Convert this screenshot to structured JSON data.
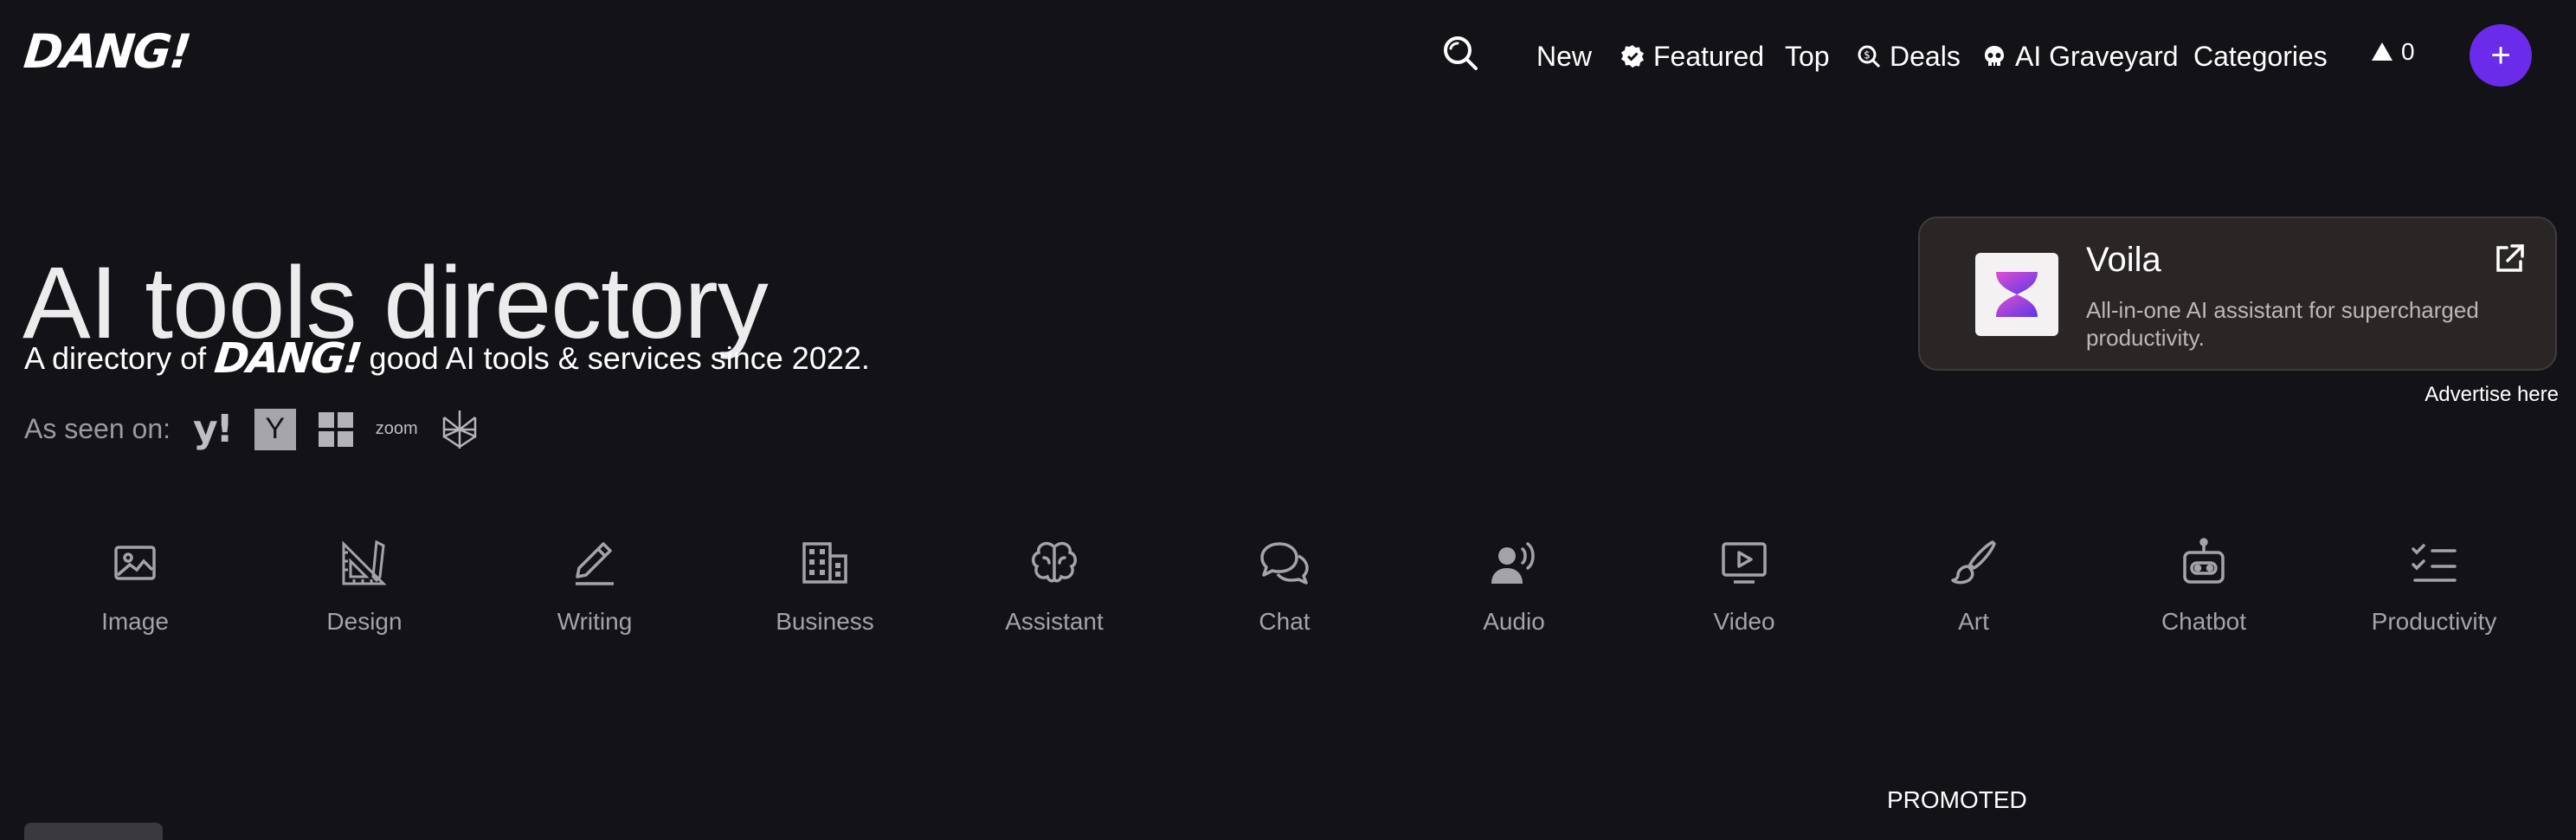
{
  "header": {
    "logo_text": "DANG!",
    "nav": [
      {
        "label": "New"
      },
      {
        "label": "Featured"
      },
      {
        "label": "Top"
      },
      {
        "label": "Deals"
      },
      {
        "label": "AI Graveyard"
      },
      {
        "label": "Categories"
      }
    ],
    "notification_count": "0",
    "add_label": "+"
  },
  "hero": {
    "title": "AI tools directory",
    "subtitle_before": "A directory of",
    "subtitle_logo": "DANG!",
    "subtitle_after": "good AI tools & services since 2022.",
    "seen_on_label": "As seen on:",
    "press": {
      "yahoo": "y!",
      "ycombinator": "Y",
      "zoom": "zoom"
    }
  },
  "promo": {
    "name": "Voila",
    "description": "All-in-one AI assistant for supercharged productivity.",
    "advertise_label": "Advertise here",
    "promoted_label": "PROMOTED"
  },
  "categories": [
    {
      "label": "Image",
      "icon": "image-icon"
    },
    {
      "label": "Design",
      "icon": "design-icon"
    },
    {
      "label": "Writing",
      "icon": "pencil-icon"
    },
    {
      "label": "Business",
      "icon": "building-icon"
    },
    {
      "label": "Assistant",
      "icon": "brain-icon"
    },
    {
      "label": "Chat",
      "icon": "chat-icon"
    },
    {
      "label": "Audio",
      "icon": "audio-icon"
    },
    {
      "label": "Video",
      "icon": "video-icon"
    },
    {
      "label": "Art",
      "icon": "brush-icon"
    },
    {
      "label": "Chatbot",
      "icon": "robot-icon"
    },
    {
      "label": "Productivity",
      "icon": "checklist-icon"
    }
  ],
  "colors": {
    "background": "#131217",
    "accent": "#6a2bea",
    "card": "#2a2626",
    "muted_text": "#a3a3a8"
  }
}
